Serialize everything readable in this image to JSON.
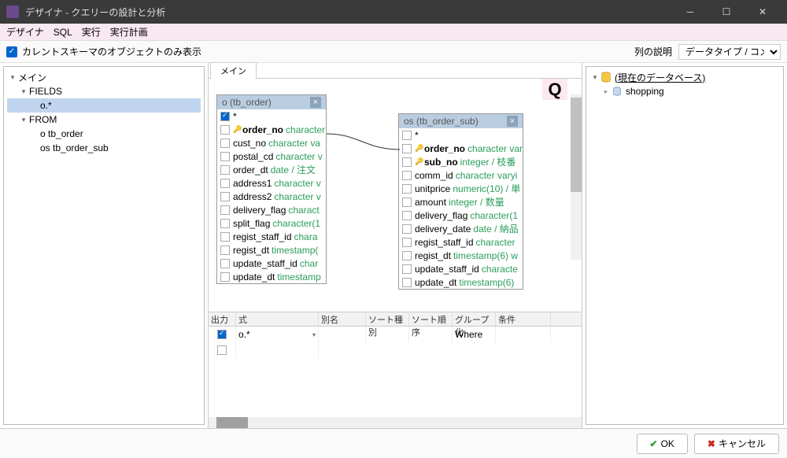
{
  "titlebar": {
    "title": "デザイナ - クエリーの設計と分析"
  },
  "menubar": {
    "items": [
      "デザイナ",
      "SQL",
      "実行",
      "実行計画"
    ]
  },
  "toolbar": {
    "schema_only_label": "カレントスキーマのオブジェクトのみ表示",
    "column_desc_label": "列の説明",
    "column_desc_value": "データタイプ / コメント"
  },
  "left_tree": {
    "root": "メイン",
    "fields": "FIELDS",
    "field_items": [
      "o.*"
    ],
    "from": "FROM",
    "from_items": [
      "o tb_order",
      "os tb_order_sub"
    ]
  },
  "center": {
    "tab": "メイン",
    "q_button": "Q"
  },
  "table1": {
    "title": "o (tb_order)",
    "columns": [
      {
        "checked": true,
        "key": false,
        "name": "*",
        "type": "",
        "bold": false
      },
      {
        "checked": false,
        "key": true,
        "name": "order_no",
        "type": "character v",
        "bold": true
      },
      {
        "checked": false,
        "key": false,
        "name": "cust_no",
        "type": "character va",
        "bold": false
      },
      {
        "checked": false,
        "key": false,
        "name": "postal_cd",
        "type": "character v",
        "bold": false
      },
      {
        "checked": false,
        "key": false,
        "name": "order_dt",
        "type": "date / 注文",
        "bold": false
      },
      {
        "checked": false,
        "key": false,
        "name": "address1",
        "type": "character v",
        "bold": false
      },
      {
        "checked": false,
        "key": false,
        "name": "address2",
        "type": "character v",
        "bold": false
      },
      {
        "checked": false,
        "key": false,
        "name": "delivery_flag",
        "type": "charact",
        "bold": false
      },
      {
        "checked": false,
        "key": false,
        "name": "split_flag",
        "type": "character(1",
        "bold": false
      },
      {
        "checked": false,
        "key": false,
        "name": "regist_staff_id",
        "type": "chara",
        "bold": false
      },
      {
        "checked": false,
        "key": false,
        "name": "regist_dt",
        "type": "timestamp(",
        "bold": false
      },
      {
        "checked": false,
        "key": false,
        "name": "update_staff_id",
        "type": "char",
        "bold": false
      },
      {
        "checked": false,
        "key": false,
        "name": "update_dt",
        "type": "timestamp",
        "bold": false
      }
    ]
  },
  "table2": {
    "title": "os (tb_order_sub)",
    "columns": [
      {
        "checked": false,
        "key": false,
        "name": "*",
        "type": "",
        "bold": false
      },
      {
        "checked": false,
        "key": true,
        "name": "order_no",
        "type": "character vary",
        "bold": true
      },
      {
        "checked": false,
        "key": true,
        "name": "sub_no",
        "type": "integer / 枝番",
        "bold": true
      },
      {
        "checked": false,
        "key": false,
        "name": "comm_id",
        "type": "character varyi",
        "bold": false
      },
      {
        "checked": false,
        "key": false,
        "name": "unitprice",
        "type": "numeric(10) / 単",
        "bold": false
      },
      {
        "checked": false,
        "key": false,
        "name": "amount",
        "type": "integer / 数量",
        "bold": false
      },
      {
        "checked": false,
        "key": false,
        "name": "delivery_flag",
        "type": "character(1",
        "bold": false
      },
      {
        "checked": false,
        "key": false,
        "name": "delivery_date",
        "type": "date / 納品",
        "bold": false
      },
      {
        "checked": false,
        "key": false,
        "name": "regist_staff_id",
        "type": "character",
        "bold": false
      },
      {
        "checked": false,
        "key": false,
        "name": "regist_dt",
        "type": "timestamp(6) w",
        "bold": false
      },
      {
        "checked": false,
        "key": false,
        "name": "update_staff_id",
        "type": "characte",
        "bold": false
      },
      {
        "checked": false,
        "key": false,
        "name": "update_dt",
        "type": "timestamp(6)",
        "bold": false
      }
    ]
  },
  "grid": {
    "headers": [
      "出力",
      "式",
      "別名",
      "ソート種別",
      "ソート順序",
      "グループ化",
      "条件"
    ],
    "row": {
      "output": true,
      "expr": "o.*",
      "group": "Where"
    }
  },
  "right_tree": {
    "root": "(現在のデータベース)",
    "items": [
      "shopping"
    ]
  },
  "footer": {
    "ok": "OK",
    "cancel": "キャンセル"
  }
}
